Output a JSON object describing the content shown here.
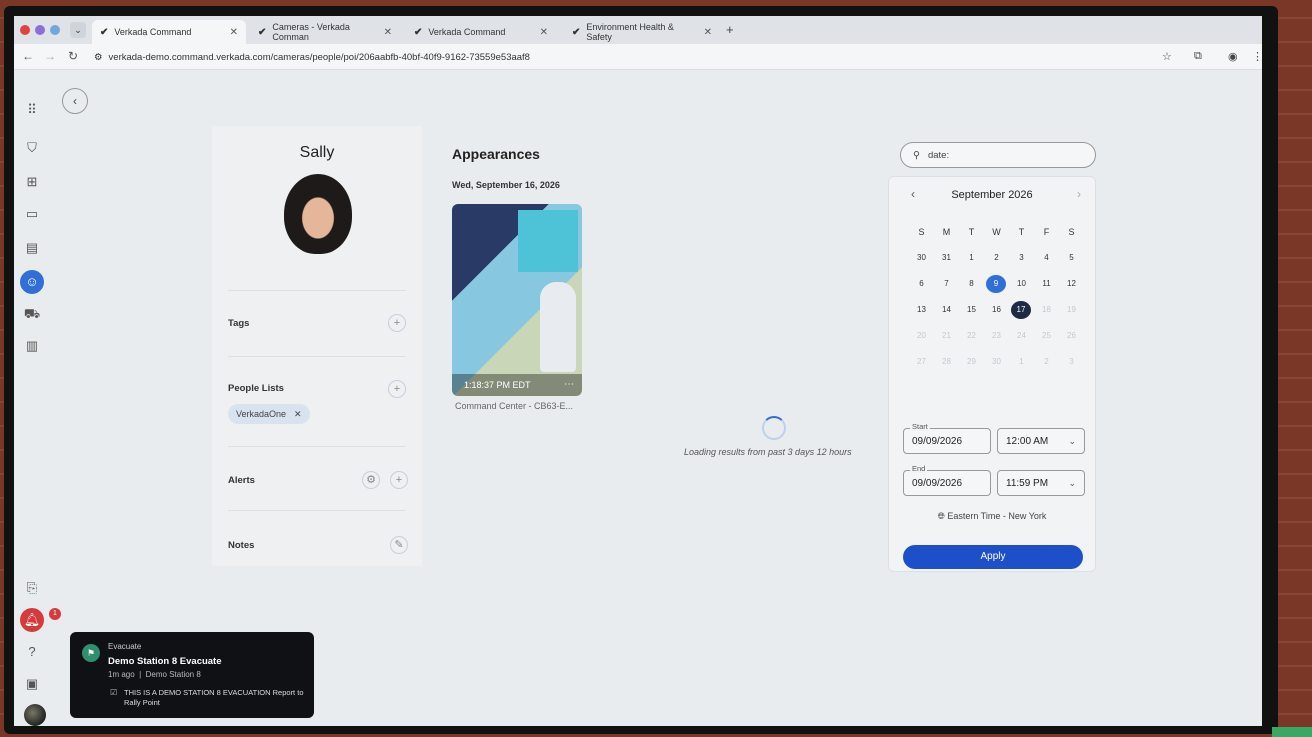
{
  "browser": {
    "tabs": [
      {
        "label": "Verkada Command"
      },
      {
        "label": "Cameras - Verkada Comman"
      },
      {
        "label": "Verkada Command"
      },
      {
        "label": "Environment Health & Safety"
      }
    ],
    "url": "verkada-demo.command.verkada.com/cameras/people/poi/206aabfb-40bf-40f9-9162-73559e53aaf8"
  },
  "profile": {
    "name": "Sally",
    "tags_label": "Tags",
    "people_lists_label": "People Lists",
    "people_list_chip": "VerkadaOne",
    "alerts_label": "Alerts",
    "notes_label": "Notes"
  },
  "appearances": {
    "title": "Appearances",
    "date": "Wed, September 16, 2026",
    "thumb_time": "1:18:37 PM EDT",
    "thumb_caption": "Command Center - CB63-E...",
    "loading_text": "Loading results from past 3 days 12 hours"
  },
  "search": {
    "value": "date:"
  },
  "calendar": {
    "month": "September 2026",
    "weekdays": [
      "S",
      "M",
      "T",
      "W",
      "T",
      "F",
      "S"
    ],
    "weeks": [
      [
        "30",
        "31",
        "1",
        "2",
        "3",
        "4",
        "5"
      ],
      [
        "6",
        "7",
        "8",
        "9",
        "10",
        "11",
        "12"
      ],
      [
        "13",
        "14",
        "15",
        "16",
        "17",
        "18",
        "19"
      ],
      [
        "20",
        "21",
        "22",
        "23",
        "24",
        "25",
        "26"
      ],
      [
        "27",
        "28",
        "29",
        "30",
        "1",
        "2",
        "3"
      ]
    ],
    "start_label": "Start",
    "start_date": "09/09/2026",
    "start_time": "12:00 AM",
    "end_label": "End",
    "end_date": "09/09/2026",
    "end_time": "11:59 PM",
    "timezone": "Eastern Time - New York",
    "apply_label": "Apply"
  },
  "notification": {
    "type": "Evacuate",
    "title": "Demo Station 8 Evacuate",
    "meta_time": "1m ago",
    "meta_place": "Demo Station 8",
    "body": "THIS IS A DEMO STATION 8 EVACUATION Report to Rally Point",
    "badge_count": "1"
  },
  "colors": {
    "accent": "#2f6fd6",
    "apply": "#1d4fc9",
    "alert": "#d63b3b"
  }
}
